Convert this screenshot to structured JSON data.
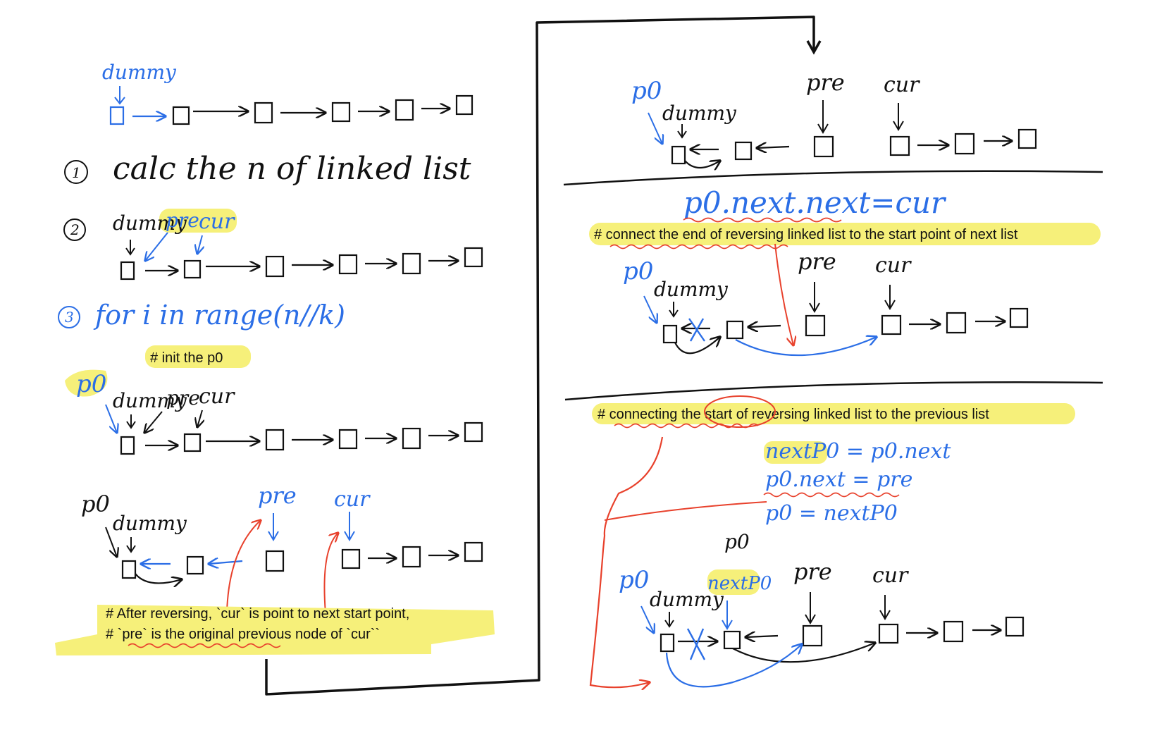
{
  "colors": {
    "ink": "#111111",
    "blue": "#2b6ee6",
    "red": "#e8412c",
    "highlight": "#f6f07a"
  },
  "left": {
    "diagram_a": {
      "dummy_label": "dummy"
    },
    "step1": {
      "number": "1",
      "text": "calc the n of linked list"
    },
    "step2": {
      "number": "2",
      "dummy_label": "dummy",
      "pre_label": "pre",
      "cur_label": "cur"
    },
    "step3": {
      "number": "3",
      "text": "for i in range(n//k)"
    },
    "note_init": "# init the p0",
    "diagram_c": {
      "p0_label": "p0",
      "dummy_label": "dummy",
      "pre_label": "pre",
      "cur_label": "cur"
    },
    "diagram_d": {
      "p0_label": "p0",
      "dummy_label": "dummy",
      "pre_label": "pre",
      "cur_label": "cur"
    },
    "note_after_line1": "# After reversing, `cur` is point to next start point,",
    "note_after_line2": "# `pre` is the original previous node of `cur``"
  },
  "right": {
    "panel1": {
      "p0_label": "p0",
      "dummy_label": "dummy",
      "pre_label": "pre",
      "cur_label": "cur"
    },
    "code1": "p0.next.next=cur",
    "note_connect_end": "# connect the end of reversing linked list to the start point of next list",
    "panel2": {
      "p0_label": "p0",
      "dummy_label": "dummy",
      "pre_label": "pre",
      "cur_label": "cur"
    },
    "note_connect_start": "# connecting the start of reversing linked list to the previous list",
    "code2_line1": "nextP0 = p0.next",
    "code2_line2": "p0.next = pre",
    "code2_line3": "p0 = nextP0",
    "panel3": {
      "p0_top_label": "p0",
      "p0_label": "p0",
      "dummy_label": "dummy",
      "nextp0_label": "nextP0",
      "pre_label": "pre",
      "cur_label": "cur"
    }
  }
}
